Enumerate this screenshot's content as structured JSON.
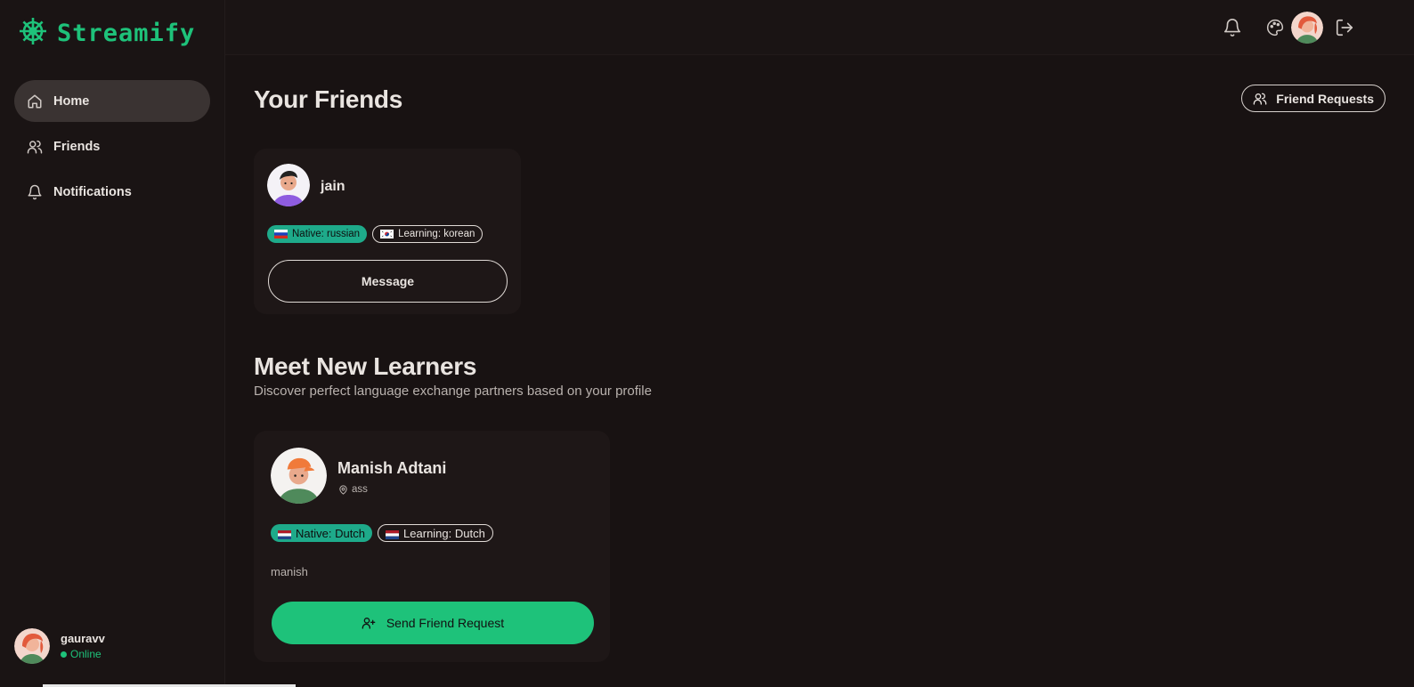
{
  "app": {
    "name": "Streamify"
  },
  "sidebar": {
    "items": [
      {
        "label": "Home",
        "icon": "home-icon",
        "active": true
      },
      {
        "label": "Friends",
        "icon": "users-icon",
        "active": false
      },
      {
        "label": "Notifications",
        "icon": "bell-icon",
        "active": false
      }
    ],
    "user": {
      "name": "gauravv",
      "status": "Online"
    }
  },
  "header": {
    "icons": [
      "bell-icon",
      "palette-icon",
      "avatar",
      "logout-icon"
    ]
  },
  "friends_section": {
    "title": "Your Friends",
    "requests_button": "Friend Requests",
    "friends": [
      {
        "name": "jain",
        "native": "Native: russian",
        "learning": "Learning: korean",
        "message_label": "Message"
      }
    ]
  },
  "learners_section": {
    "title": "Meet New Learners",
    "subtitle": "Discover perfect language exchange partners based on your profile",
    "learners": [
      {
        "name": "Manish Adtani",
        "location": "ass",
        "native": "Native: Dutch",
        "learning": "Learning: Dutch",
        "bio": "manish",
        "button_label": "Send Friend Request"
      }
    ]
  },
  "colors": {
    "accent": "#1ec27a",
    "native_badge": "#1eaa8a",
    "background": "#1a1414"
  }
}
